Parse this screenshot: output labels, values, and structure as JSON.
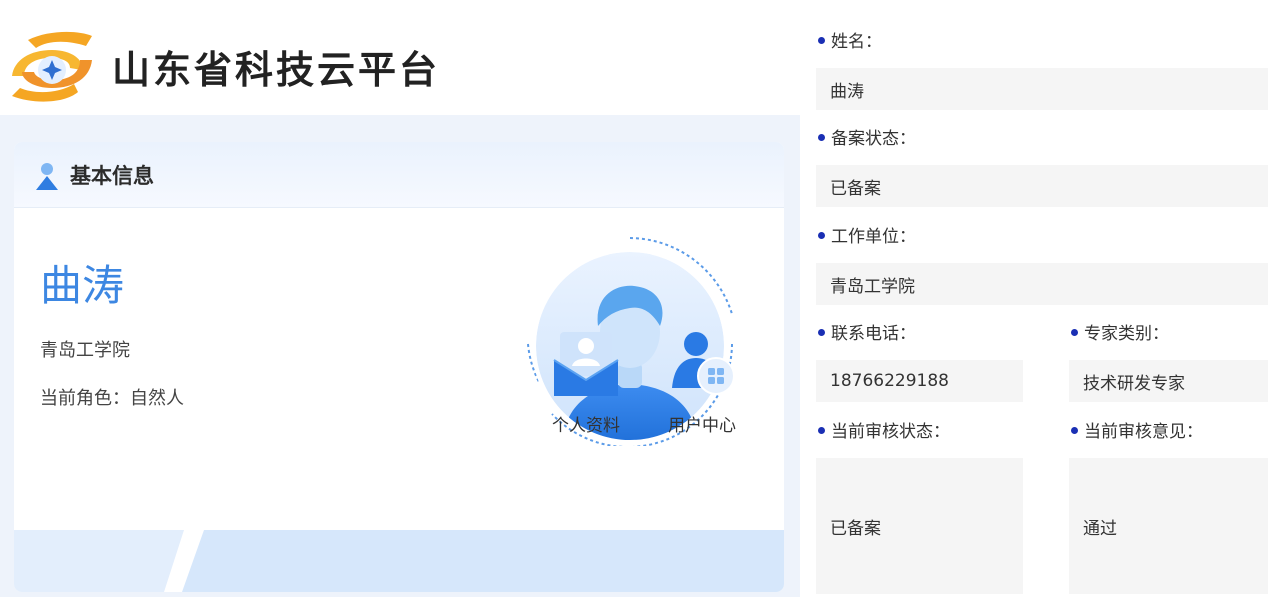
{
  "header": {
    "site_title": "山东省科技云平台",
    "logo_icon": "swirl-logo-icon"
  },
  "card": {
    "title": "基本信息",
    "title_icon": "user-icon",
    "name": "曲涛",
    "org": "青岛工学院",
    "role": "当前角色：自然人",
    "avatar_icon": "avatar-person-icon",
    "shortcuts": [
      {
        "label": "个人资料",
        "icon": "profile-envelope-icon"
      },
      {
        "label": "用户中心",
        "icon": "user-center-icon"
      }
    ]
  },
  "form": {
    "name_label": "姓名：",
    "name_value": "曲涛",
    "status_label": "备案状态：",
    "status_value": "已备案",
    "org_label": "工作单位：",
    "org_value": "青岛工学院",
    "phone_label": "联系电话：",
    "phone_value": "18766229188",
    "expert_type_label": "专家类别：",
    "expert_type_value": "技术研发专家",
    "review_status_label": "当前审核状态：",
    "review_status_value": "已备案",
    "review_opinion_label": "当前审核意见：",
    "review_opinion_value": "通过"
  },
  "colors": {
    "accent_blue": "#3d87e2",
    "label_dot": "#1a2fb4",
    "field_bg": "#f5f5f5",
    "panel_bg": "#eef3fb"
  }
}
